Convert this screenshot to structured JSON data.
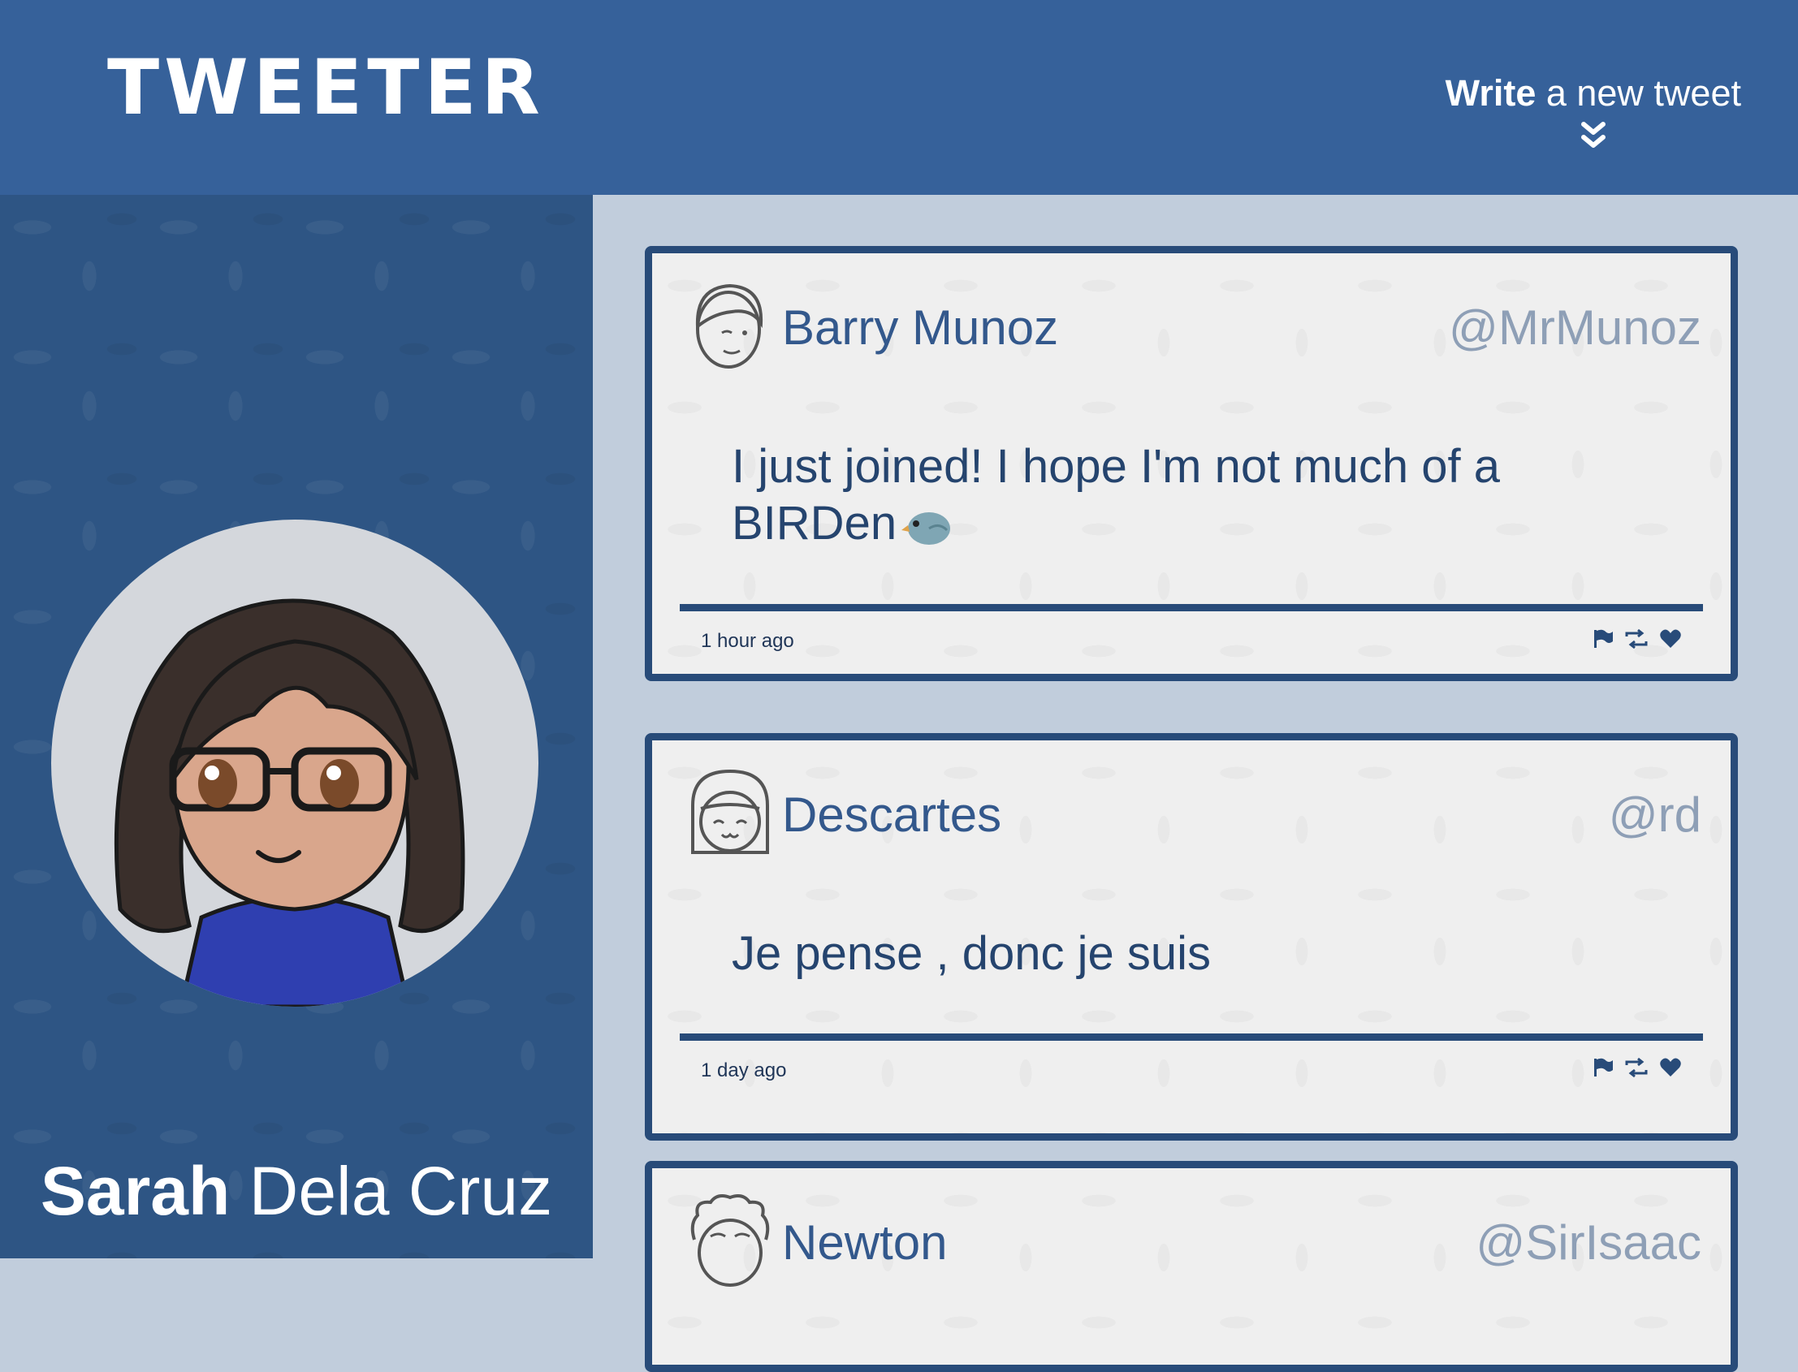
{
  "header": {
    "brand": "TWEETER",
    "compose_bold": "Write",
    "compose_rest": " a new tweet"
  },
  "profile": {
    "first_name": "Sarah",
    "last_name": " Dela Cruz"
  },
  "tweets": [
    {
      "name": "Barry Munoz",
      "handle": "@MrMunoz",
      "text": "I just joined! I hope I'm not much of a BIRDen",
      "time": "1 hour ago",
      "avatar_icon": "boy-face-icon"
    },
    {
      "name": "Descartes",
      "handle": "@rd",
      "text": "Je pense , donc je suis",
      "time": "1 day ago",
      "avatar_icon": "bangs-face-icon"
    },
    {
      "name": "Newton",
      "handle": "@SirIsaac",
      "text": "",
      "time": "",
      "avatar_icon": "curly-hair-face-icon"
    }
  ],
  "colors": {
    "header_bg": "#36619a",
    "sidebar_bg": "#2e5584",
    "feed_bg": "#c1cddc",
    "tweet_border": "#284b79",
    "tweet_name": "#33588c",
    "tweet_handle": "#8e9fb6"
  }
}
